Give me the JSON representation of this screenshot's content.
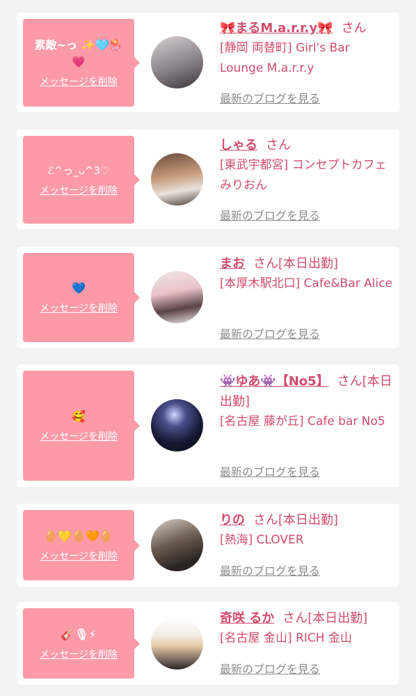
{
  "delete_label": "メッセージを削除",
  "blog_label": "最新のブログを見る",
  "cards": [
    {
      "message": "素敵~っ ✨🩵🪼💗",
      "name": "🎀まるM.a.r.r.y🎀",
      "san": "さん",
      "shop": "[静岡 両替町] Girl's Bar Lounge M.a.r.r.y"
    },
    {
      "message": "ℰ^っ_ᴗ^3♡",
      "name": "しゃる",
      "san": "さん",
      "shop": "[東武宇都宮] コンセプトカフェみりおん"
    },
    {
      "message": "💙",
      "name": "まお",
      "san": "さん[本日出勤]",
      "shop": "[本厚木駅北口] Cafe&Bar Alice"
    },
    {
      "message": "🥰",
      "name": "👾ゆあ👾【No5】",
      "san": "さん[本日出勤]",
      "shop": "[名古屋 藤が丘] Cafe bar No5"
    },
    {
      "message": "🥚💛🥚🧡🥚",
      "name": "りの",
      "san": "さん[本日出勤]",
      "shop": "[熱海] CLOVER"
    },
    {
      "message": "🎸🎙⚡",
      "name": "奇咲 るか",
      "san": "さん[本日出勤]",
      "shop": "[名古屋 金山] RICH 金山"
    }
  ],
  "colors": {
    "accent": "#d14b6a",
    "bubble": "#fc9aa8",
    "background": "#f2f2f3"
  }
}
